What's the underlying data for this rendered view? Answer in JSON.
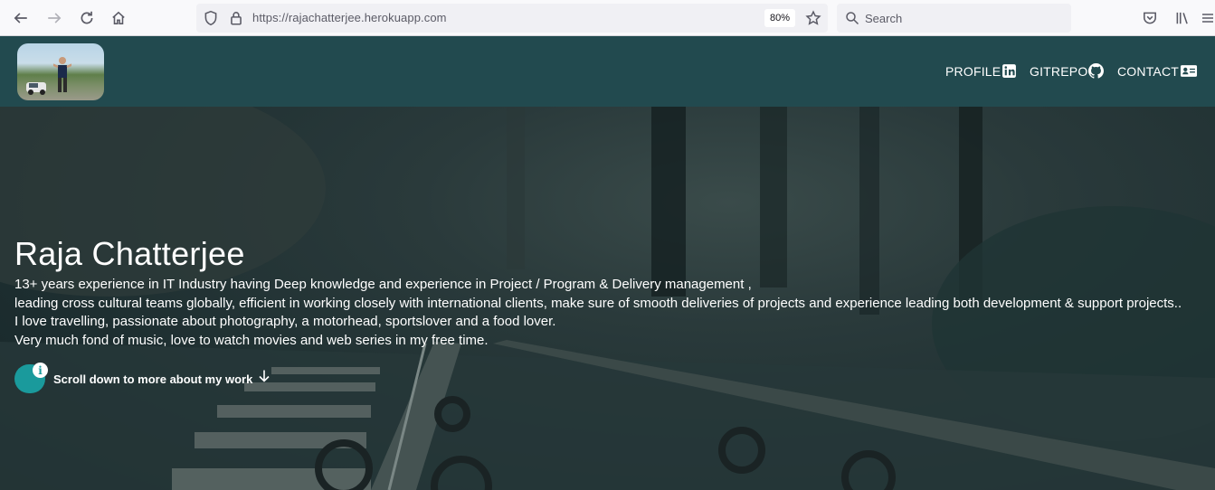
{
  "browser": {
    "url": "https://rajachatterjee.herokuapp.com",
    "zoom": "80%",
    "search_placeholder": "Search",
    "icons": [
      "back-icon",
      "forward-icon",
      "reload-icon",
      "home-icon",
      "shield-icon",
      "lock-icon",
      "bookmark-star-icon",
      "search-icon",
      "pocket-icon",
      "library-icon",
      "menu-icon"
    ]
  },
  "header": {
    "nav": [
      {
        "label": "PROFILE",
        "icon": "linkedin-icon"
      },
      {
        "label": "GITREPO",
        "icon": "github-icon"
      },
      {
        "label": "CONTACT",
        "icon": "contact-card-icon"
      }
    ]
  },
  "hero": {
    "name": "Raja Chatterjee",
    "lines": [
      "13+ years experience in IT Industry having Deep knowledge and experience in Project / Program & Delivery management ,",
      "leading cross cultural teams globally, efficient in working closely with international clients, make sure of smooth deliveries of projects and experience leading both development & support projects..",
      "I love travelling, passionate about photography, a motorhead, sportslover and a food lover.",
      "Very much fond of music, love to watch movies and web series in my free time."
    ],
    "cta": "Scroll down to more about my work",
    "info_glyph": "i"
  },
  "colors": {
    "header_bg": "#224a4f",
    "toggle": "#1a9a9c"
  }
}
